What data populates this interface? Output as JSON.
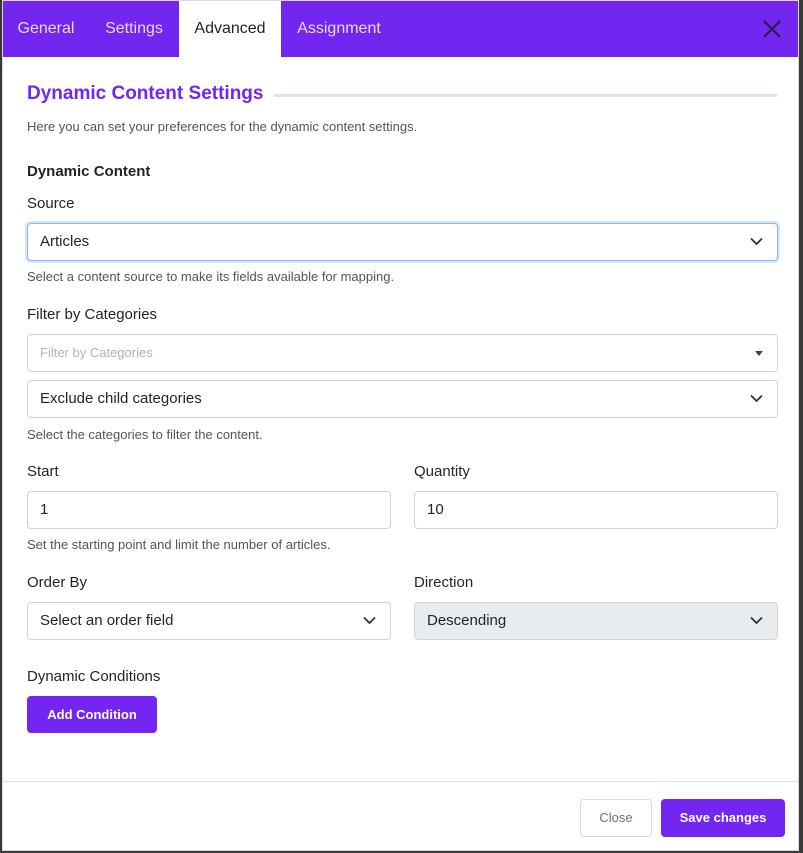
{
  "tabs": [
    {
      "label": "General"
    },
    {
      "label": "Settings"
    },
    {
      "label": "Advanced"
    },
    {
      "label": "Assignment"
    }
  ],
  "section": {
    "title": "Dynamic Content Settings",
    "intro": "Here you can set your preferences for the dynamic content settings."
  },
  "dynamic_content": {
    "heading": "Dynamic Content",
    "source_label": "Source",
    "source_value": "Articles",
    "source_help": "Select a content source to make its fields available for mapping.",
    "filter_label": "Filter by Categories",
    "filter_placeholder": "Filter by Categories",
    "child_value": "Exclude child categories",
    "filter_help": "Select the categories to filter the content.",
    "start_label": "Start",
    "start_value": "1",
    "quantity_label": "Quantity",
    "quantity_value": "10",
    "range_help": "Set the starting point and limit the number of articles.",
    "order_label": "Order By",
    "order_value": "Select an order field",
    "direction_label": "Direction",
    "direction_value": "Descending",
    "conditions_label": "Dynamic Conditions",
    "add_condition": "Add Condition"
  },
  "footer": {
    "close": "Close",
    "save": "Save changes"
  },
  "colors": {
    "accent": "#7226f0",
    "focus_border": "#86b7fe",
    "disabled_bg": "#e9ecef"
  },
  "icons": {
    "close": "close-icon",
    "chevron": "chevron-down-icon",
    "caret": "caret-down-icon"
  }
}
